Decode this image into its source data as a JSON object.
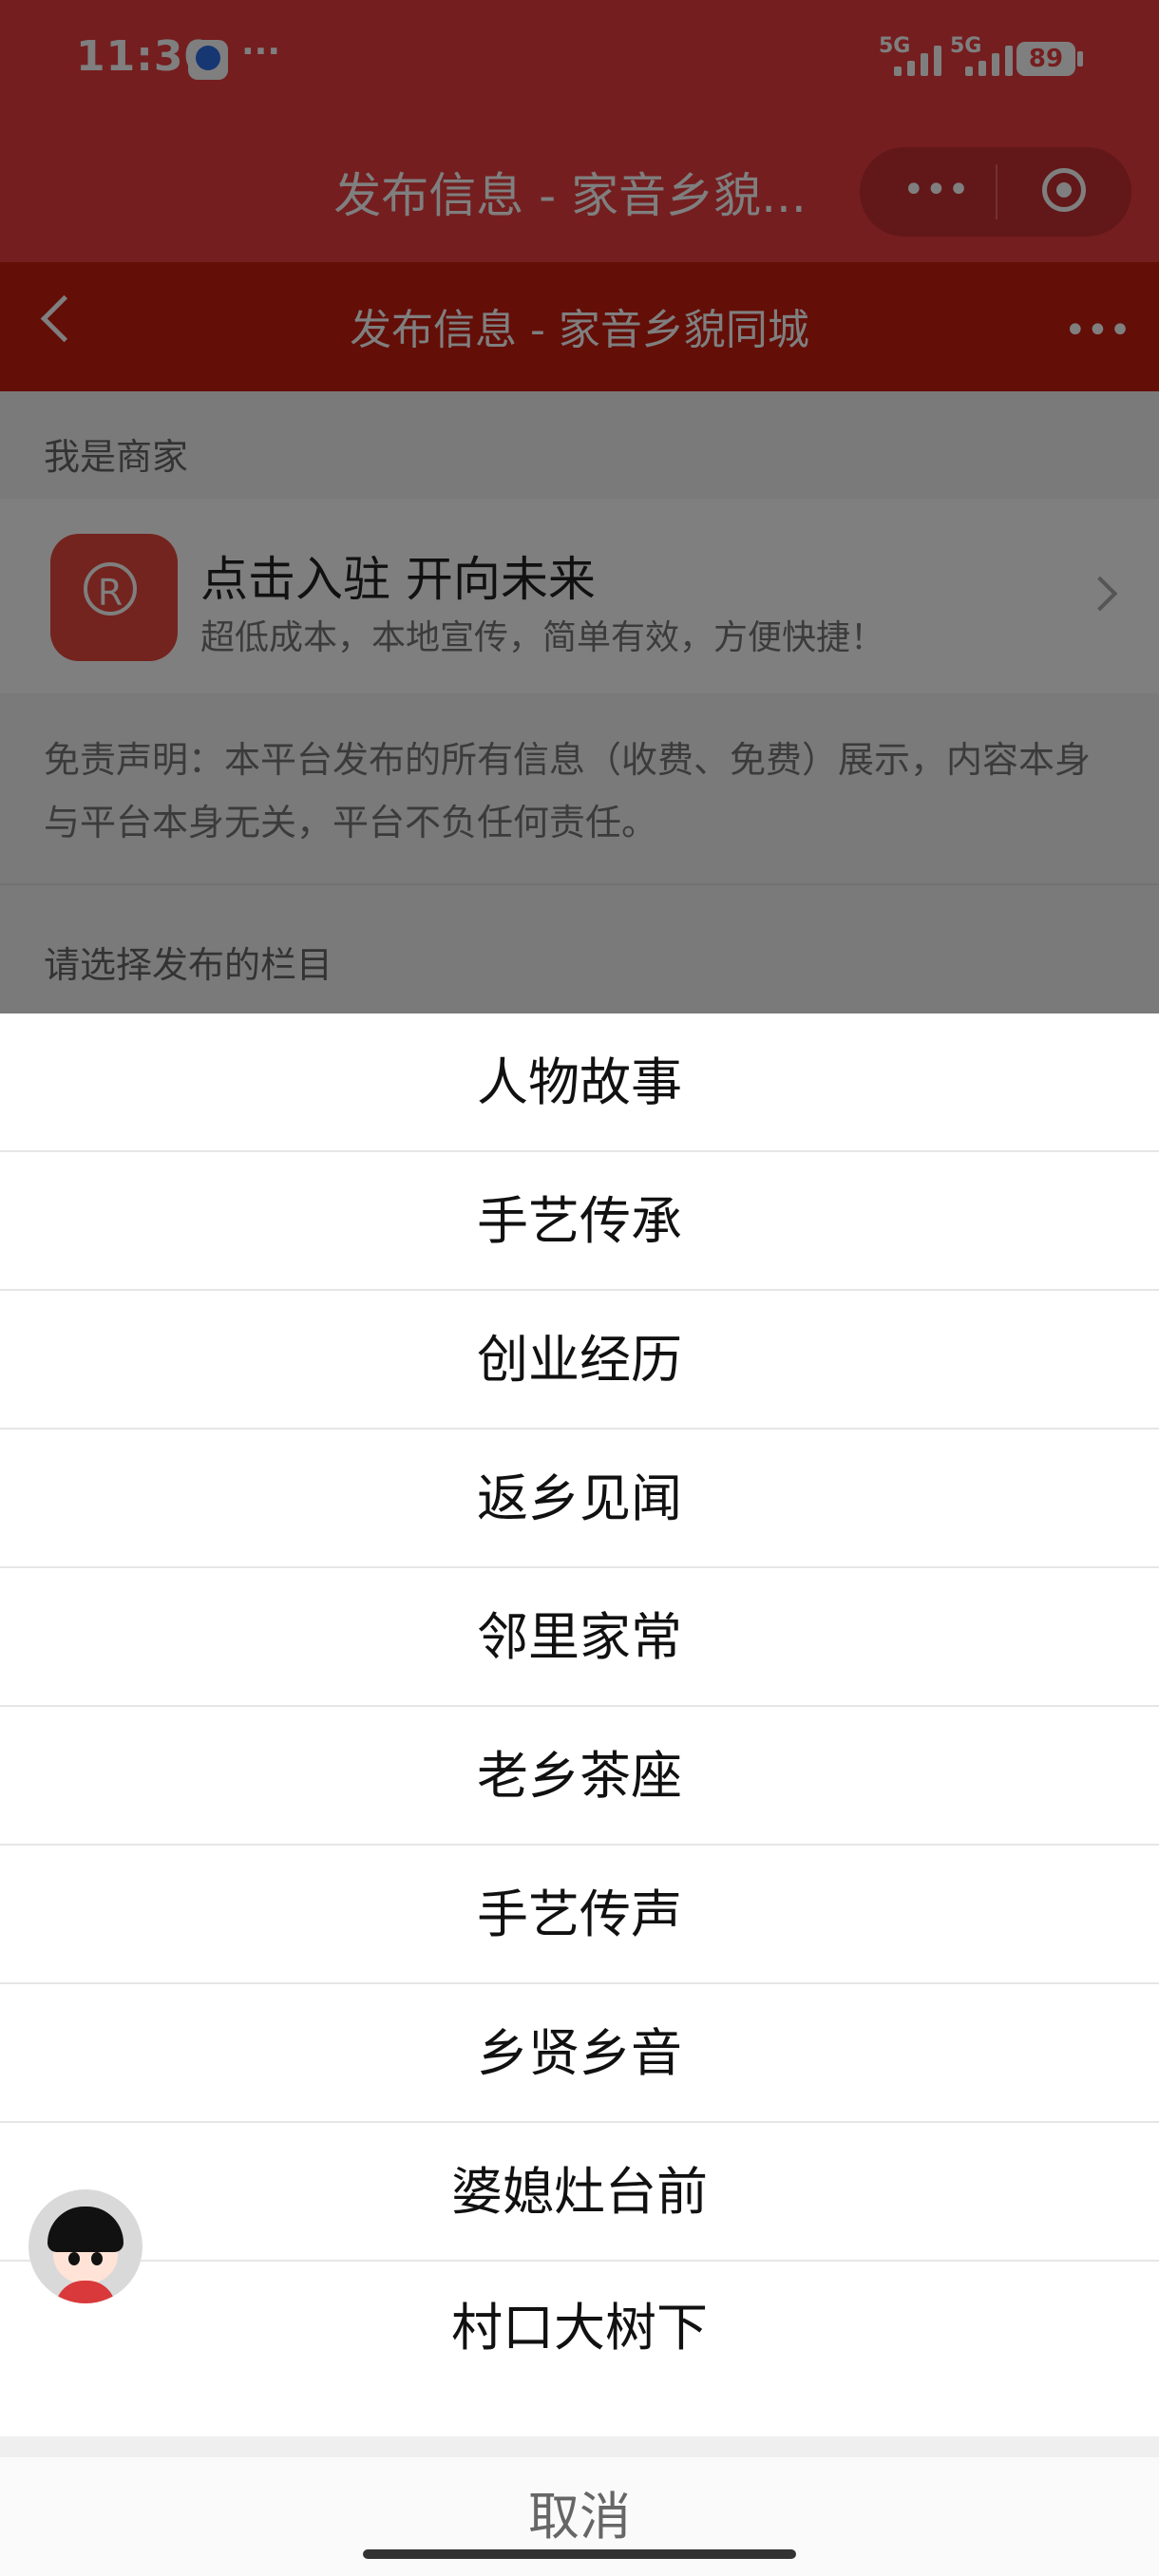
{
  "status_bar": {
    "time": "11:30",
    "more": "···",
    "signal_label_1": "5G",
    "signal_label_2": "5G",
    "battery": "89"
  },
  "wechat_bar": {
    "title": "发布信息 - 家音乡貌...",
    "capsule_more": "•••"
  },
  "page": {
    "header_title": "发布信息 - 家音乡貌同城",
    "header_more": "•••",
    "merchant_section_label": "我是商家",
    "merchant": {
      "logo_letter": "R",
      "title": "点击入驻 开向未来",
      "subtitle": "超低成本，本地宣传，简单有效，方便快捷！"
    },
    "disclaimer": "免责声明：本平台发布的所有信息（收费、免费）展示，内容本身与平台本身无关，平台不负任何责任。",
    "column_section_label": "请选择发布的栏目"
  },
  "action_sheet": {
    "options": [
      "人物故事",
      "手艺传承",
      "创业经历",
      "返乡见闻",
      "邻里家常",
      "老乡茶座",
      "手艺传声",
      "乡贤乡音",
      "婆媳灶台前",
      "村口大树下"
    ],
    "cancel": "取消"
  }
}
